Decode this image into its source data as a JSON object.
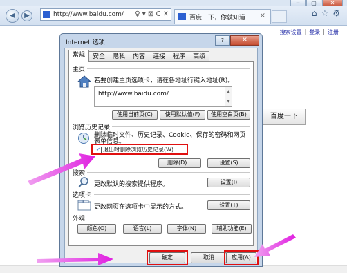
{
  "browser": {
    "window_buttons": [
      "─",
      "▢",
      "✕"
    ],
    "address": "http://www.baidu.com/",
    "address_tools": "♀ ▾ ⊠ C ✕",
    "tab_title": "百度一下，你就知道",
    "tab_close": "×",
    "right_icons": [
      "⌂",
      "☆",
      "⚙"
    ]
  },
  "page": {
    "top_links": [
      "搜索设置",
      "登录",
      "注册"
    ],
    "search_button": "百度一下"
  },
  "dialog": {
    "title": "Internet 选项",
    "help": "?",
    "close": "✕",
    "tabs": [
      "常规",
      "安全",
      "隐私",
      "内容",
      "连接",
      "程序",
      "高级"
    ],
    "homepage": {
      "heading": "主页",
      "desc": "若要创建主页选项卡，请在各地址行键入地址(R)。",
      "url": "http://www.baidu.com/",
      "btn_current": "使用当前页(C)",
      "btn_default": "使用默认值(F)",
      "btn_blank": "使用空白页(B)"
    },
    "history": {
      "heading": "浏览历史记录",
      "desc1": "删除临时文件、历史记录、Cookie、保存的密码和网页",
      "desc2": "表单信息。",
      "checkbox_label": "退出时删除浏览历史记录(W)",
      "checked_mark": "✓",
      "btn_delete": "删除(D)...",
      "btn_settings": "设置(S)"
    },
    "search": {
      "heading": "搜索",
      "desc": "更改默认的搜索提供程序。",
      "btn_settings": "设置(I)"
    },
    "tabs_section": {
      "heading": "选项卡",
      "desc": "更改网页在选项卡中显示的方式。",
      "btn_settings": "设置(T)"
    },
    "appearance": {
      "heading": "外观",
      "btn_colors": "颜色(O)",
      "btn_languages": "语言(L)",
      "btn_fonts": "字体(N)",
      "btn_accessibility": "辅助功能(E)"
    },
    "footer": {
      "ok": "确定",
      "cancel": "取消",
      "apply": "应用(A)"
    }
  },
  "colors": {
    "highlight_red": "#e01010",
    "arrow_magenta": "#e040e0"
  }
}
